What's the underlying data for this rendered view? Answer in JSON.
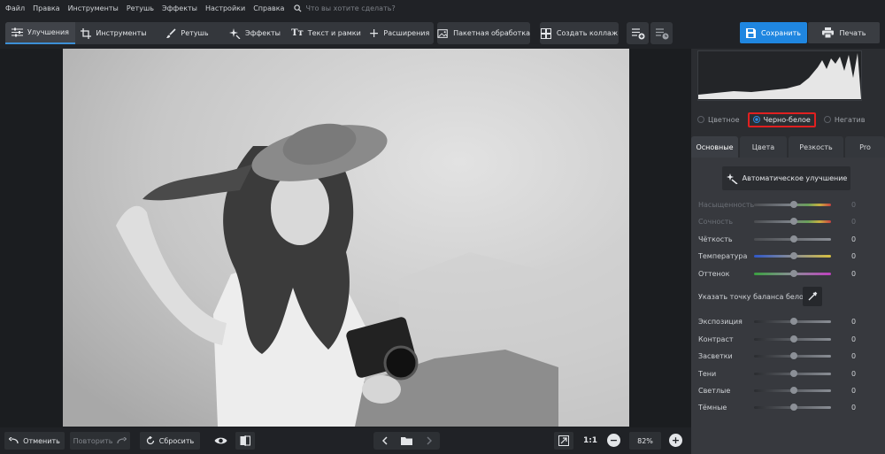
{
  "menu": {
    "items": [
      "Файл",
      "Правка",
      "Инструменты",
      "Ретушь",
      "Эффекты",
      "Настройки",
      "Справка"
    ],
    "search_placeholder": "Что вы хотите сделать?"
  },
  "toolbar": {
    "tabs": [
      {
        "label": "Улучшения",
        "icon": "sliders-icon",
        "active": true
      },
      {
        "label": "Инструменты",
        "icon": "crop-icon"
      },
      {
        "label": "Ретушь",
        "icon": "brush-icon"
      },
      {
        "label": "Эффекты",
        "icon": "sparkle-icon"
      },
      {
        "label": "Текст и рамки",
        "icon": "text-icon"
      },
      {
        "label": "Расширения",
        "icon": "plus-icon"
      }
    ],
    "batch_label": "Пакетная обработка",
    "collage_label": "Создать коллаж",
    "save_label": "Сохранить",
    "print_label": "Печать"
  },
  "panel": {
    "color_modes": [
      {
        "label": "Цветное",
        "selected": false
      },
      {
        "label": "Черно-белое",
        "selected": true
      },
      {
        "label": "Негатив",
        "selected": false
      }
    ],
    "tabs": [
      "Основные",
      "Цвета",
      "Резкость",
      "Pro"
    ],
    "active_tab": "Основные",
    "auto_label": "Автоматическое улучшение",
    "sliders": [
      {
        "label": "Насыщенность",
        "value": "0",
        "disabled": true
      },
      {
        "label": "Сочность",
        "value": "0",
        "disabled": true
      },
      {
        "label": "Чёткость",
        "value": "0"
      },
      {
        "label": "Температура",
        "value": "0"
      },
      {
        "label": "Оттенок",
        "value": "0"
      },
      {
        "label": "Экспозиция",
        "value": "0"
      },
      {
        "label": "Контраст",
        "value": "0"
      },
      {
        "label": "Засветки",
        "value": "0"
      },
      {
        "label": "Тени",
        "value": "0"
      },
      {
        "label": "Светлые",
        "value": "0"
      },
      {
        "label": "Тёмные",
        "value": "0"
      }
    ],
    "white_balance_label": "Указать точку баланса белого"
  },
  "bottom": {
    "undo_label": "Отменить",
    "redo_label": "Повторить",
    "reset_label": "Сбросить",
    "zoom_fit_label": "1:1",
    "zoom_value": "82%"
  },
  "colors": {
    "accent": "#1f86e0",
    "highlight_frame": "#e02020"
  }
}
